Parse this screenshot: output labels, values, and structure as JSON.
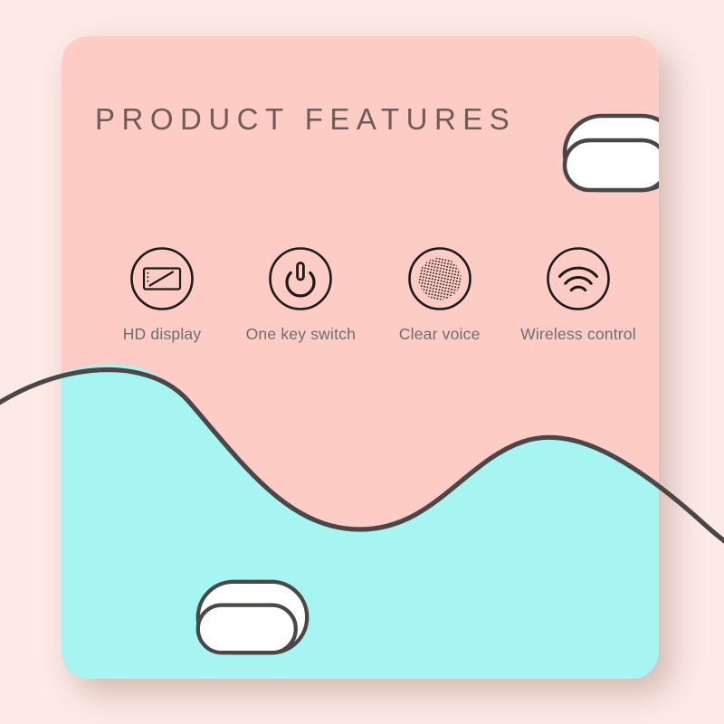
{
  "page": {
    "background_color": "#fde9e5",
    "card": {
      "top_color": "#fcccc5",
      "bottom_color": "#a6f5f2",
      "wave_line_color": "#4a4746"
    }
  },
  "header": {
    "title": "PRODUCT FEATURES",
    "title_color": "#6e5d57"
  },
  "illustrations": [
    {
      "name": "speaker-device-top",
      "stroke": "#4a4746",
      "fill": "#ffffff"
    },
    {
      "name": "speaker-device-bottom",
      "stroke": "#4a4746",
      "fill": "#ffffff"
    }
  ],
  "features": [
    {
      "icon": "hd-display-icon",
      "label": "HD display"
    },
    {
      "icon": "power-button-icon",
      "label": "One key switch"
    },
    {
      "icon": "speaker-grille-icon",
      "label": "Clear voice"
    },
    {
      "icon": "wifi-signal-icon",
      "label": "Wireless control"
    }
  ],
  "colors": {
    "pink": "#fcccc5",
    "teal": "#a6f5f2",
    "outer_pink": "#fde9e5",
    "ink": "#4a4746",
    "label_gray": "#6e6e6e"
  }
}
